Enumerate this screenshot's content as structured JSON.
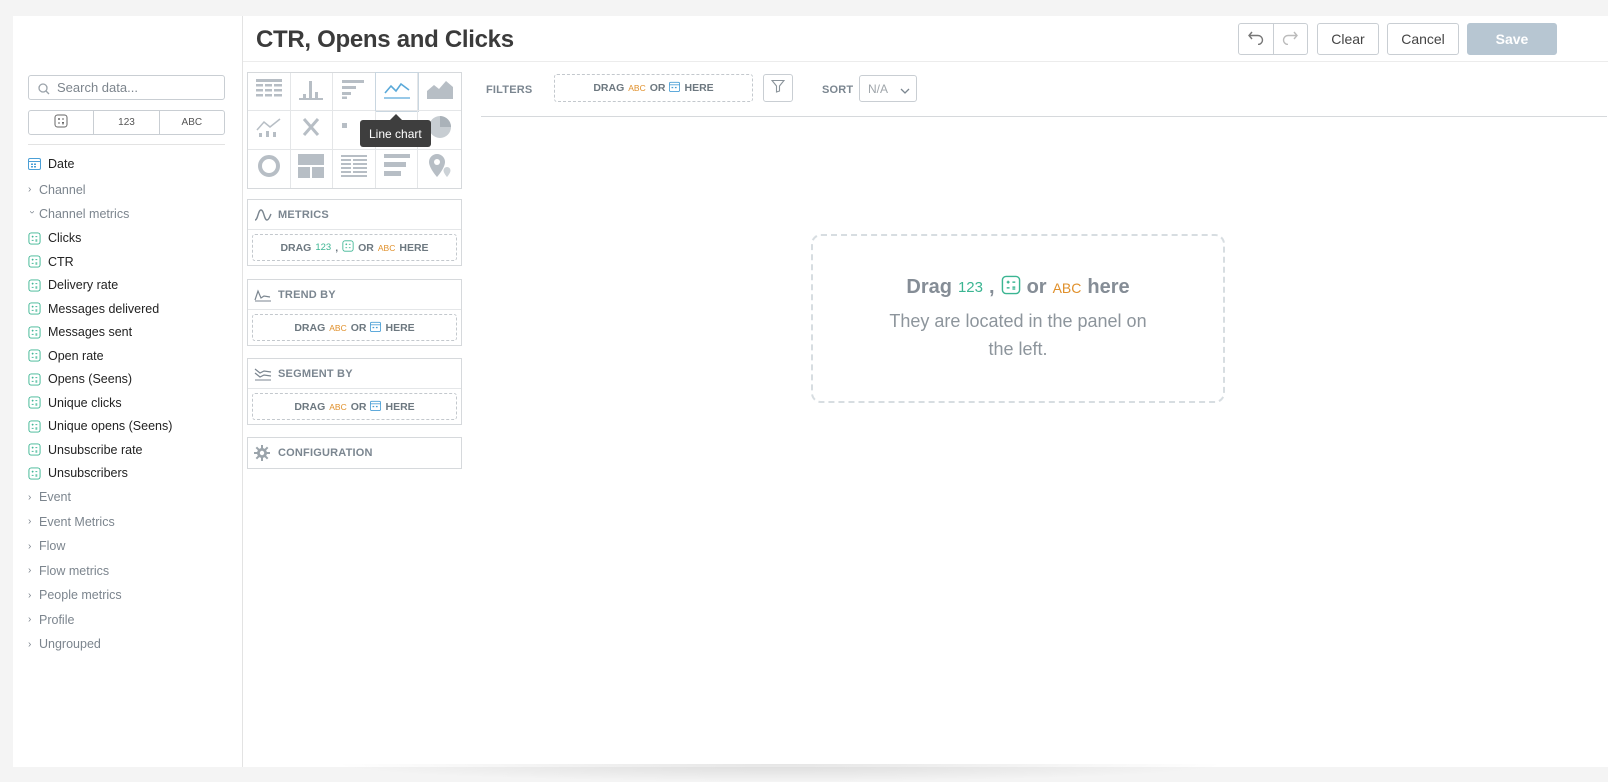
{
  "header": {
    "title": "CTR, Opens and Clicks",
    "clear_label": "Clear",
    "cancel_label": "Cancel",
    "save_label": "Save"
  },
  "sidebar": {
    "search_placeholder": "Search data...",
    "type_filters": [
      "123",
      "ABC"
    ],
    "date_item": "Date",
    "groups_before": [
      "Channel"
    ],
    "expanded_group": "Channel metrics",
    "metrics": [
      "Clicks",
      "CTR",
      "Delivery rate",
      "Messages delivered",
      "Messages sent",
      "Open rate",
      "Opens (Seens)",
      "Unique clicks",
      "Unique opens (Seens)",
      "Unsubscribe rate",
      "Unsubscribers"
    ],
    "groups_after": [
      "Event",
      "Event Metrics",
      "Flow",
      "Flow metrics",
      "People metrics",
      "Profile",
      "Ungrouped"
    ]
  },
  "chart_types": {
    "tooltip": "Line chart"
  },
  "panels": {
    "metrics_title": "METRICS",
    "trend_title": "TREND BY",
    "segment_title": "SEGMENT BY",
    "config_title": "CONFIGURATION",
    "drag": "DRAG",
    "or": "OR",
    "here": "HERE",
    "comma": ",",
    "num_tag": "123",
    "abc_tag": "ABC"
  },
  "toolbar": {
    "filters_label": "FILTERS",
    "sort_label": "SORT",
    "sort_value": "N/A"
  },
  "empty_state": {
    "drag": "Drag",
    "num_tag": "123",
    "comma": ",",
    "or": "or",
    "abc_tag": "ABC",
    "here": "here",
    "hint": "They are located in the panel on the left."
  },
  "colors": {
    "numeric_tag": "#3bb592",
    "text_tag": "#e0902b",
    "date_icon": "#4a9fd6",
    "save_button": "#b7c6d2",
    "tooltip_bg": "#3e3e3e"
  }
}
